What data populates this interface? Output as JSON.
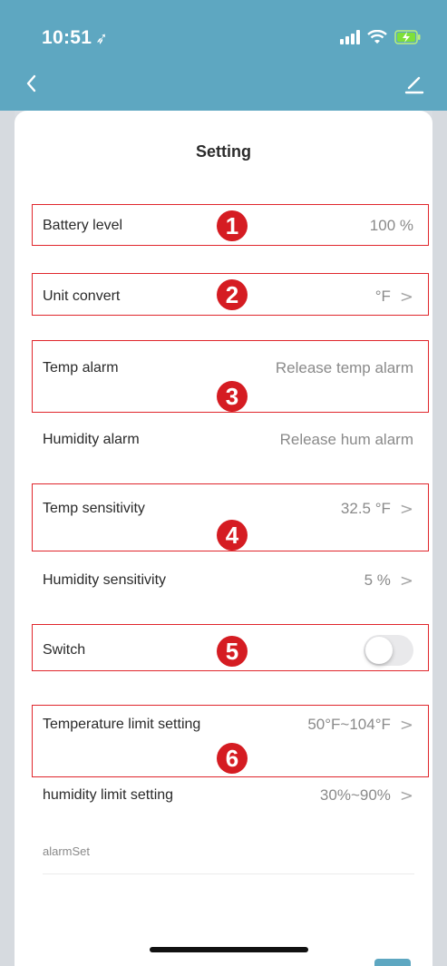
{
  "status_bar": {
    "time": "10:51",
    "location_arrow": "location-arrow-icon"
  },
  "nav": {
    "back_icon": "chevron-left-icon",
    "edit_icon": "edit-pencil-icon"
  },
  "title": "Setting",
  "rows": {
    "battery": {
      "label": "Battery level",
      "value": "100 %"
    },
    "unit": {
      "label": "Unit convert",
      "value": "°F"
    },
    "temp_alarm": {
      "label": "Temp alarm",
      "value": "Release temp alarm"
    },
    "hum_alarm": {
      "label": "Humidity alarm",
      "value": "Release hum alarm"
    },
    "temp_sens": {
      "label": "Temp sensitivity",
      "value": "32.5 °F"
    },
    "hum_sens": {
      "label": "Humidity sensitivity",
      "value": "5 %"
    },
    "switch": {
      "label": "Switch",
      "on": false
    },
    "temp_limit": {
      "label": "Temperature limit setting",
      "value": "50°F~104°F"
    },
    "hum_limit": {
      "label": "humidity limit setting",
      "value": "30%~90%"
    }
  },
  "section_footer": "alarmSet",
  "badges": [
    "1",
    "2",
    "3",
    "4",
    "5",
    "6"
  ],
  "colors": {
    "header": "#5ea7c1",
    "annotation": "#d51c22"
  }
}
